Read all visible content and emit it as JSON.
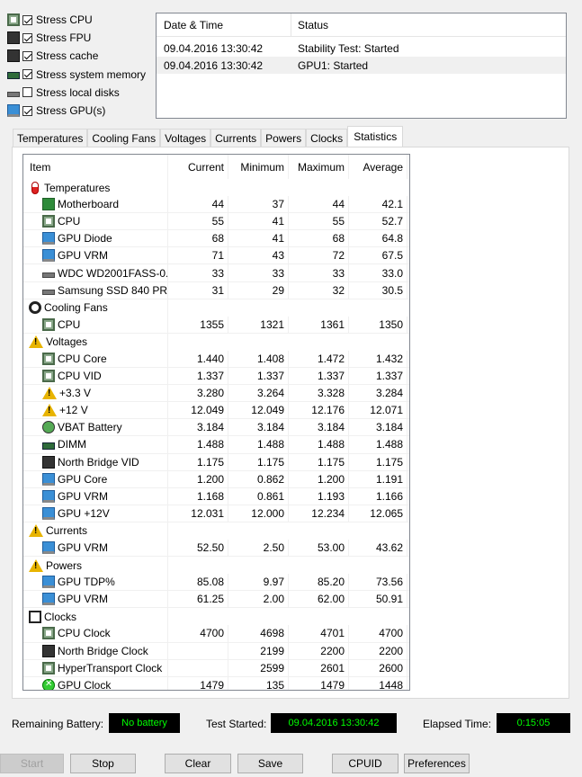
{
  "stress_options": [
    {
      "label": "Stress CPU",
      "checked": true,
      "icon": "cpu-chip-icon"
    },
    {
      "label": "Stress FPU",
      "checked": true,
      "icon": "fpu-chip-icon"
    },
    {
      "label": "Stress cache",
      "checked": true,
      "icon": "cache-icon"
    },
    {
      "label": "Stress system memory",
      "checked": true,
      "icon": "memory-icon"
    },
    {
      "label": "Stress local disks",
      "checked": false,
      "icon": "disk-icon"
    },
    {
      "label": "Stress GPU(s)",
      "checked": true,
      "icon": "gpu-monitor-icon"
    }
  ],
  "status_log": {
    "col_date": "Date & Time",
    "col_status": "Status",
    "rows": [
      {
        "date": "09.04.2016 13:30:42",
        "status": "Stability Test: Started"
      },
      {
        "date": "09.04.2016 13:30:42",
        "status": "GPU1: Started"
      }
    ]
  },
  "tabs": [
    "Temperatures",
    "Cooling Fans",
    "Voltages",
    "Currents",
    "Powers",
    "Clocks",
    "Statistics"
  ],
  "active_tab": "Statistics",
  "stats": {
    "headers": {
      "item": "Item",
      "current": "Current",
      "minimum": "Minimum",
      "maximum": "Maximum",
      "average": "Average"
    },
    "rows": [
      {
        "type": "group",
        "icon": "thermometer-icon",
        "label": "Temperatures"
      },
      {
        "type": "item",
        "icon": "motherboard-icon",
        "label": "Motherboard",
        "cur": "44",
        "min": "37",
        "max": "44",
        "avg": "42.1"
      },
      {
        "type": "item",
        "icon": "cpu-chip-icon",
        "label": "CPU",
        "cur": "55",
        "min": "41",
        "max": "55",
        "avg": "52.7"
      },
      {
        "type": "item",
        "icon": "gpu-monitor-icon",
        "label": "GPU Diode",
        "cur": "68",
        "min": "41",
        "max": "68",
        "avg": "64.8"
      },
      {
        "type": "item",
        "icon": "gpu-monitor-icon",
        "label": "GPU VRM",
        "cur": "71",
        "min": "43",
        "max": "72",
        "avg": "67.5"
      },
      {
        "type": "item",
        "icon": "disk-icon",
        "label": "WDC WD2001FASS-0...",
        "cur": "33",
        "min": "33",
        "max": "33",
        "avg": "33.0"
      },
      {
        "type": "item",
        "icon": "disk-icon",
        "label": "Samsung SSD 840 PR...",
        "cur": "31",
        "min": "29",
        "max": "32",
        "avg": "30.5"
      },
      {
        "type": "group",
        "icon": "fan-icon",
        "label": "Cooling Fans"
      },
      {
        "type": "item",
        "icon": "cpu-chip-icon",
        "label": "CPU",
        "cur": "1355",
        "min": "1321",
        "max": "1361",
        "avg": "1350"
      },
      {
        "type": "group",
        "icon": "warning-icon",
        "label": "Voltages"
      },
      {
        "type": "item",
        "icon": "cpu-chip-icon",
        "label": "CPU Core",
        "cur": "1.440",
        "min": "1.408",
        "max": "1.472",
        "avg": "1.432"
      },
      {
        "type": "item",
        "icon": "cpu-chip-icon",
        "label": "CPU VID",
        "cur": "1.337",
        "min": "1.337",
        "max": "1.337",
        "avg": "1.337"
      },
      {
        "type": "item",
        "icon": "warning-icon",
        "label": "+3.3 V",
        "cur": "3.280",
        "min": "3.264",
        "max": "3.328",
        "avg": "3.284"
      },
      {
        "type": "item",
        "icon": "warning-icon",
        "label": "+12 V",
        "cur": "12.049",
        "min": "12.049",
        "max": "12.176",
        "avg": "12.071"
      },
      {
        "type": "item",
        "icon": "battery-icon",
        "label": "VBAT Battery",
        "cur": "3.184",
        "min": "3.184",
        "max": "3.184",
        "avg": "3.184"
      },
      {
        "type": "item",
        "icon": "memory-icon",
        "label": "DIMM",
        "cur": "1.488",
        "min": "1.488",
        "max": "1.488",
        "avg": "1.488"
      },
      {
        "type": "item",
        "icon": "northbridge-icon",
        "label": "North Bridge VID",
        "cur": "1.175",
        "min": "1.175",
        "max": "1.175",
        "avg": "1.175"
      },
      {
        "type": "item",
        "icon": "gpu-monitor-icon",
        "label": "GPU Core",
        "cur": "1.200",
        "min": "0.862",
        "max": "1.200",
        "avg": "1.191"
      },
      {
        "type": "item",
        "icon": "gpu-monitor-icon",
        "label": "GPU VRM",
        "cur": "1.168",
        "min": "0.861",
        "max": "1.193",
        "avg": "1.166"
      },
      {
        "type": "item",
        "icon": "gpu-monitor-icon",
        "label": "GPU +12V",
        "cur": "12.031",
        "min": "12.000",
        "max": "12.234",
        "avg": "12.065"
      },
      {
        "type": "group",
        "icon": "warning-icon",
        "label": "Currents"
      },
      {
        "type": "item",
        "icon": "gpu-monitor-icon",
        "label": "GPU VRM",
        "cur": "52.50",
        "min": "2.50",
        "max": "53.00",
        "avg": "43.62"
      },
      {
        "type": "group",
        "icon": "warning-icon",
        "label": "Powers"
      },
      {
        "type": "item",
        "icon": "gpu-monitor-icon",
        "label": "GPU TDP%",
        "cur": "85.08",
        "min": "9.97",
        "max": "85.20",
        "avg": "73.56"
      },
      {
        "type": "item",
        "icon": "gpu-monitor-icon",
        "label": "GPU VRM",
        "cur": "61.25",
        "min": "2.00",
        "max": "62.00",
        "avg": "50.91"
      },
      {
        "type": "group",
        "icon": "clock-icon",
        "label": "Clocks"
      },
      {
        "type": "item",
        "icon": "cpu-chip-icon",
        "label": "CPU Clock",
        "cur": "4700",
        "min": "4698",
        "max": "4701",
        "avg": "4700"
      },
      {
        "type": "item",
        "icon": "northbridge-icon",
        "label": "North Bridge Clock",
        "cur": "",
        "min": "2199",
        "max": "2200",
        "avg": "2200"
      },
      {
        "type": "item",
        "icon": "cpu-chip-icon",
        "label": "HyperTransport Clock",
        "cur": "",
        "min": "2599",
        "max": "2601",
        "avg": "2600"
      },
      {
        "type": "item",
        "icon": "xbox-icon",
        "label": "GPU Clock",
        "cur": "1479",
        "min": "135",
        "max": "1479",
        "avg": "1448"
      }
    ]
  },
  "status_bar": {
    "battery_label": "Remaining Battery:",
    "battery_value": "No battery",
    "test_started_label": "Test Started:",
    "test_started_value": "09.04.2016 13:30:42",
    "elapsed_label": "Elapsed Time:",
    "elapsed_value": "0:15:05"
  },
  "buttons": {
    "start": "Start",
    "stop": "Stop",
    "clear": "Clear",
    "save": "Save",
    "cpuid": "CPUID",
    "preferences": "Preferences"
  },
  "colors": {
    "lcd_bg": "#000000",
    "lcd_text": "#00ff00",
    "warning": "#e8b400"
  }
}
